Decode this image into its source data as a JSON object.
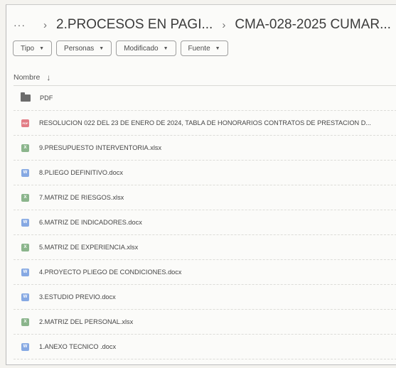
{
  "breadcrumb": {
    "more": "···",
    "crumbs": [
      "2.PROCESOS EN PAGI...",
      "CMA-028-2025 CUMAR..."
    ]
  },
  "filters": [
    {
      "label": "Tipo"
    },
    {
      "label": "Personas"
    },
    {
      "label": "Modificado"
    },
    {
      "label": "Fuente"
    }
  ],
  "columns": {
    "name_label": "Nombre"
  },
  "files": [
    {
      "name": "PDF",
      "type": "folder"
    },
    {
      "name": "RESOLUCION 022 DEL 23 DE ENERO DE 2024, TABLA DE HONORARIOS CONTRATOS DE PRESTACION D...",
      "type": "pdf",
      "icon_text": "PDF"
    },
    {
      "name": "9.PRESUPUESTO INTERVENTORIA.xlsx",
      "type": "xlsx",
      "icon_text": "X"
    },
    {
      "name": "8.PLIEGO DEFINITIVO.docx",
      "type": "docx",
      "icon_text": "W"
    },
    {
      "name": "7.MATRIZ DE RIESGOS.xlsx",
      "type": "xlsx",
      "icon_text": "X"
    },
    {
      "name": "6.MATRIZ DE INDICADORES.docx",
      "type": "docx",
      "icon_text": "W"
    },
    {
      "name": "5.MATRIZ DE EXPERIENCIA.xlsx",
      "type": "xlsx",
      "icon_text": "X"
    },
    {
      "name": "4.PROYECTO PLIEGO DE CONDICIONES.docx",
      "type": "docx",
      "icon_text": "W"
    },
    {
      "name": "3.ESTUDIO PREVIO.docx",
      "type": "docx",
      "icon_text": "W"
    },
    {
      "name": "2.MATRIZ DEL PERSONAL.xlsx",
      "type": "xlsx",
      "icon_text": "X"
    },
    {
      "name": "1.ANEXO TECNICO .docx",
      "type": "docx",
      "icon_text": "W"
    }
  ],
  "colors": {
    "pdf": "#e27d86",
    "xlsx": "#8bb58c",
    "docx": "#86a9e3",
    "folder": "#6c6c6c"
  }
}
